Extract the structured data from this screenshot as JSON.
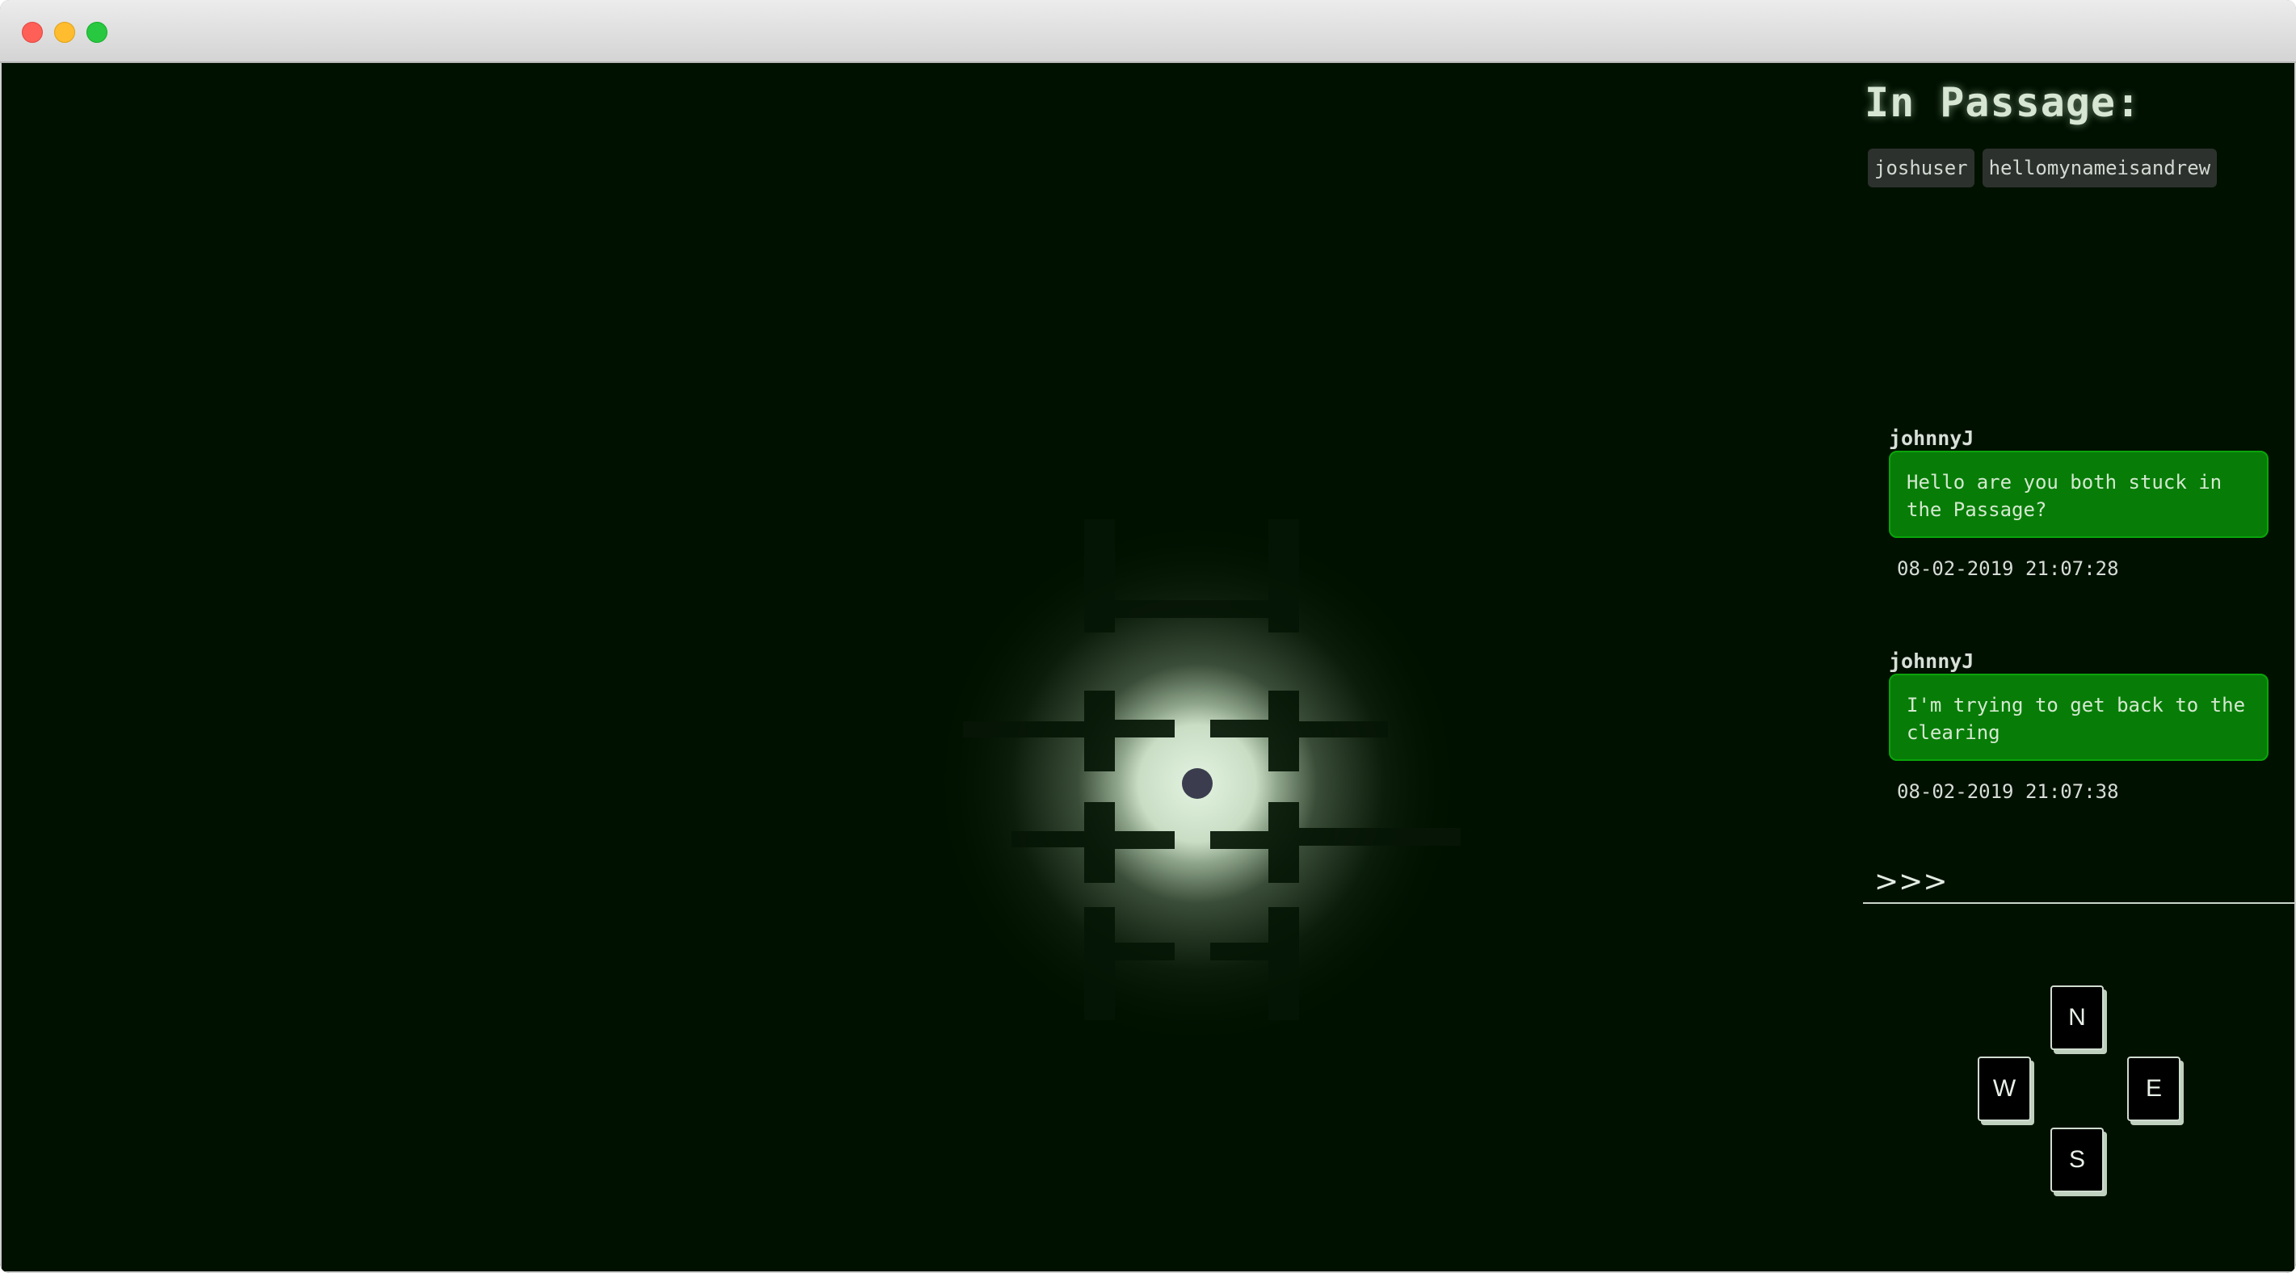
{
  "window": {
    "controls": [
      "close",
      "minimize",
      "maximize"
    ]
  },
  "sidebar": {
    "heading": "In Passage:",
    "users": [
      "joshuser",
      "hellomynameisandrew"
    ],
    "messages": [
      {
        "author": "johnnyJ",
        "text": "Hello are you both stuck in the Passage?",
        "timestamp": "08-02-2019 21:07:28"
      },
      {
        "author": "johnnyJ",
        "text": "I'm trying to get back to the clearing",
        "timestamp": "08-02-2019 21:07:38"
      }
    ],
    "prompt_symbol": ">>>",
    "prompt_value": ""
  },
  "controls": {
    "north": "N",
    "west": "W",
    "east": "E",
    "south": "S"
  },
  "colors": {
    "background": "#011100",
    "message_bubble": "#077d07",
    "light_glow": "#dff3dc",
    "player": "#3b3d4f"
  },
  "icons": {
    "player": "player-dot-icon"
  }
}
